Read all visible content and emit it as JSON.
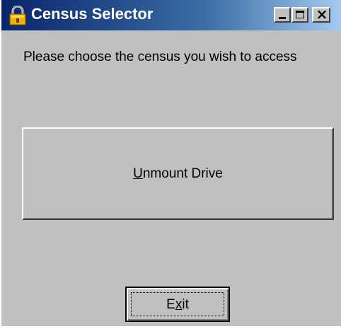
{
  "window": {
    "title": "Census Selector",
    "icon": "padlock-icon",
    "controls": {
      "minimize_icon": "minimize-icon",
      "maximize_icon": "maximize-icon",
      "close_icon": "close-icon",
      "close_glyph": "×"
    }
  },
  "main": {
    "prompt": "Please choose the census you wish to access",
    "unmount_button": {
      "mnemonic": "U",
      "rest": "nmount Drive"
    },
    "exit_button": {
      "before": "E",
      "mnemonic": "x",
      "after": "it"
    }
  },
  "colors": {
    "face": "#c0c0c0",
    "title_active": "#0a246a",
    "title_gradient_end": "#a6caf0",
    "title_text": "#ffffff",
    "text": "#000000"
  }
}
